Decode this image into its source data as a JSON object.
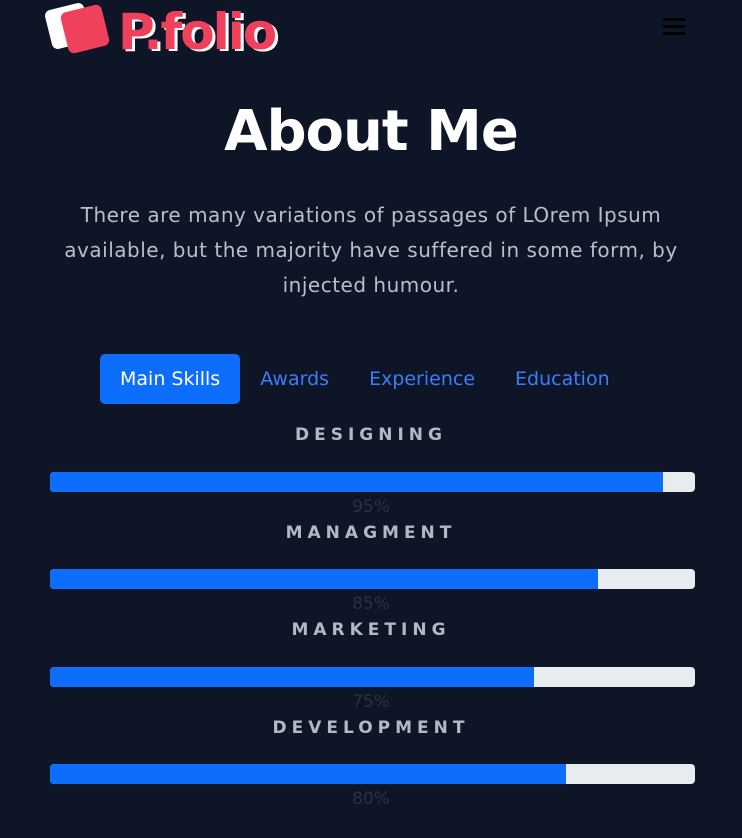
{
  "header": {
    "logo_text": "P.folio",
    "menu_icon": "hamburger-icon"
  },
  "about": {
    "title": "About Me",
    "intro": "There are many variations of passages of LOrem Ipsum available, but the majority have suffered in some form, by injected humour."
  },
  "tabs": [
    {
      "label": "Main Skills",
      "active": true
    },
    {
      "label": "Awards",
      "active": false
    },
    {
      "label": "Experience",
      "active": false
    },
    {
      "label": "Education",
      "active": false
    }
  ],
  "skills": [
    {
      "name": "DESIGNING",
      "percent_label": "95%",
      "progress": 0.95
    },
    {
      "name": "MANAGMENT",
      "percent_label": "85%",
      "progress": 0.85
    },
    {
      "name": "MARKETING",
      "percent_label": "75%",
      "progress": 0.75
    },
    {
      "name": "DEVELOPMENT",
      "percent_label": "80%",
      "progress": 0.8
    }
  ],
  "colors": {
    "background": "#0e1526",
    "accent": "#0d6efd",
    "brand": "#f0415c",
    "track": "#e9ecef"
  }
}
